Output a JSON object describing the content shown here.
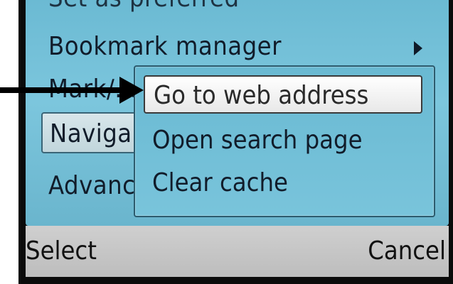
{
  "menu": {
    "top_partial_label": "Set as preferred",
    "bookmark_label": "Bookmark manager",
    "mark_label": "Mark/...",
    "navigate_label": "Naviga",
    "advanced_label": "Advanc"
  },
  "submenu": {
    "items": [
      {
        "label": "Go to web address"
      },
      {
        "label": "Open search page"
      },
      {
        "label": "Clear cache"
      }
    ]
  },
  "softkeys": {
    "left": "Select",
    "right": "Cancel"
  },
  "annotation": {
    "arrow_color": "#000000"
  },
  "colors": {
    "menu_bg": "#78c1d8",
    "highlight_bg": "#ffffff",
    "softkey_bg": "#c6c6c6",
    "text": "#111c2a"
  }
}
